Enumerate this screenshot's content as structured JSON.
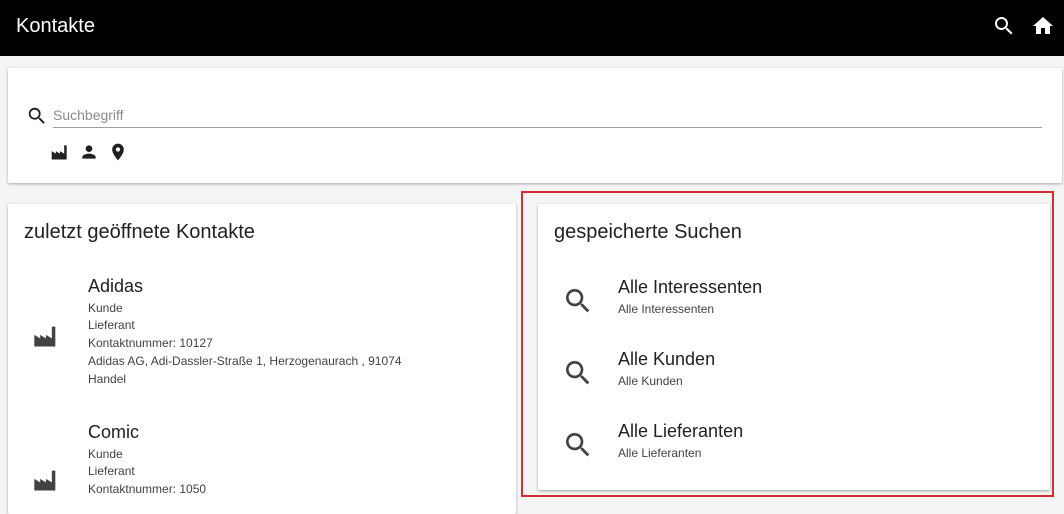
{
  "appbar": {
    "title": "Kontakte",
    "actions": [
      {
        "icon": "search-icon"
      },
      {
        "icon": "home-icon"
      }
    ]
  },
  "search": {
    "placeholder": "Suchbegriff",
    "value": "",
    "filters": [
      {
        "icon": "factory-icon"
      },
      {
        "icon": "person-icon"
      },
      {
        "icon": "location-pin-icon"
      }
    ]
  },
  "recent": {
    "title": "zuletzt geöffnete Kontakte",
    "contacts": [
      {
        "icon": "factory-icon",
        "name": "Adidas",
        "lines": [
          "Kunde",
          "Lieferant",
          "Kontaktnummer: 10127",
          "Adidas AG, Adi-Dassler-Straße 1, Herzogenaurach , 91074",
          "Handel"
        ]
      },
      {
        "icon": "factory-icon",
        "name": "Comic",
        "lines": [
          "Kunde",
          "Lieferant",
          "Kontaktnummer: 1050"
        ]
      }
    ]
  },
  "saved": {
    "title": "gespeicherte Suchen",
    "items": [
      {
        "icon": "search-icon",
        "title": "Alle Interessenten",
        "subtitle": "Alle Interessenten"
      },
      {
        "icon": "search-icon",
        "title": "Alle Kunden",
        "subtitle": "Alle Kunden"
      },
      {
        "icon": "search-icon",
        "title": "Alle Lieferanten",
        "subtitle": "Alle Lieferanten"
      }
    ]
  },
  "colors": {
    "appbar": "#000000",
    "highlight": "#d32f2f",
    "background": "#f5f5f5"
  }
}
